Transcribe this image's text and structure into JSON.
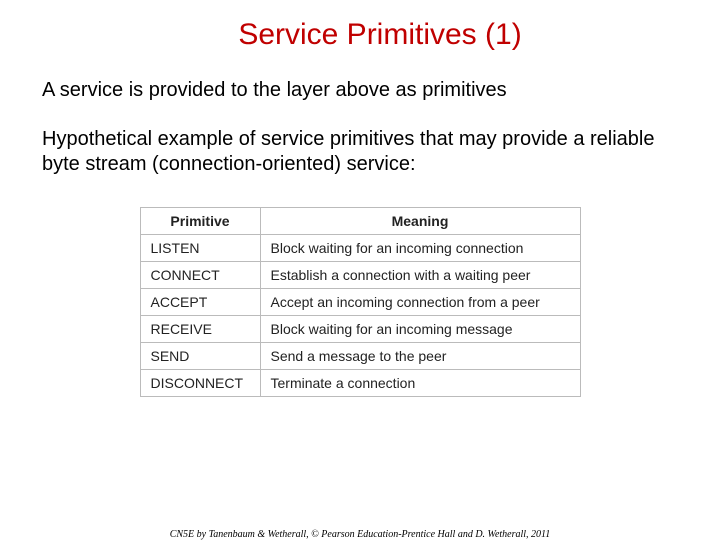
{
  "title": "Service Primitives (1)",
  "paragraph1": "A service is provided to the layer above as primitives",
  "paragraph2": "Hypothetical example of service primitives that may provide a reliable byte stream (connection-oriented) service:",
  "table": {
    "headers": {
      "col1": "Primitive",
      "col2": "Meaning"
    },
    "rows": [
      {
        "primitive": "LISTEN",
        "meaning": "Block waiting for an incoming connection"
      },
      {
        "primitive": "CONNECT",
        "meaning": "Establish a connection with a waiting peer"
      },
      {
        "primitive": "ACCEPT",
        "meaning": "Accept an incoming connection from a peer"
      },
      {
        "primitive": "RECEIVE",
        "meaning": "Block waiting for an incoming message"
      },
      {
        "primitive": "SEND",
        "meaning": "Send a message to the peer"
      },
      {
        "primitive": "DISCONNECT",
        "meaning": "Terminate a connection"
      }
    ]
  },
  "footer": "CN5E by Tanenbaum & Wetherall, © Pearson Education-Prentice Hall and D. Wetherall, 2011"
}
